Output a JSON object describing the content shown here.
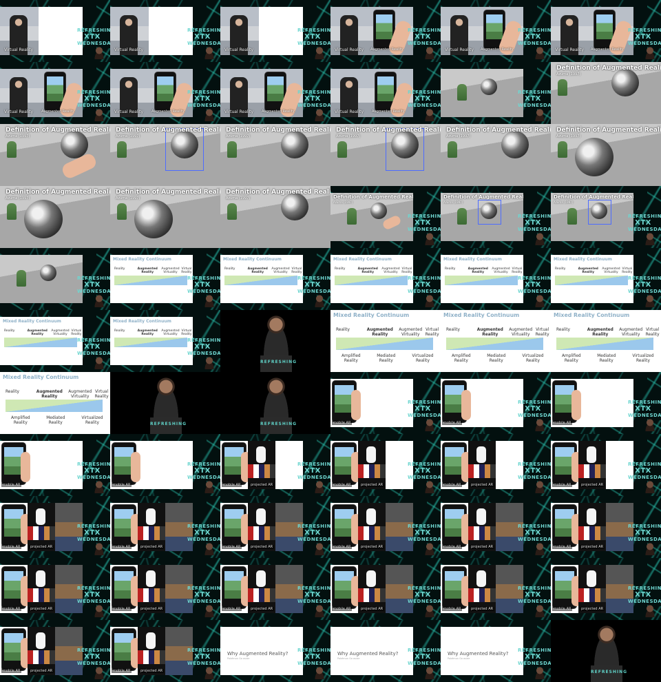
{
  "brand": {
    "line1": "REFRESHING",
    "line2": "XTX",
    "line3": "WEDNESDAY"
  },
  "podium_text": "REFRESHING",
  "captions": {
    "virtual_reality": "Virtual Reality",
    "augmented_reality": "Augmented Reality",
    "mobile_ar": "mobile AR",
    "projection_ar": "projected AR"
  },
  "definition": {
    "title": "Definition of Augmented Reality",
    "subtitle": "Azuma (1997)"
  },
  "mixed_reality": {
    "title": "Mixed Reality Continuum",
    "reality": "Reality",
    "augmented_reality": "Augmented\nReality",
    "augmented_virtuality": "Augmented\nVirtuality",
    "virtual_reality": "Virtual\nReality",
    "amplified_reality": "Amplified\nReality",
    "mediated_reality": "Mediated\nReality",
    "virtualized_reality": "Virtualized\nReality"
  },
  "why": {
    "title": "Why Augmented Reality?",
    "subtitle": "Pokémon Go aside"
  },
  "frames": [
    "vr-white",
    "vr-white",
    "vr-white",
    "ar-phone",
    "ar-phone",
    "ar-phone",
    "ar-split",
    "ar-split",
    "ar-split",
    "ar-split",
    "def-start",
    "def-globe",
    "def-hand",
    "def-box",
    "def-globe",
    "def-box",
    "def-globe",
    "def-big",
    "def-big",
    "def-big",
    "def-globe",
    "def-hand-sm",
    "def-box-sm",
    "def-box-sm",
    "def-brand",
    "mr-small",
    "mr-small",
    "mr-small",
    "mr-small",
    "mr-small",
    "mr-small-b",
    "mr-small-b",
    "speaker",
    "mr-full",
    "mr-full",
    "mr-full",
    "mr-full-lg",
    "speaker-wide",
    "speaker-wide",
    "mobile",
    "mobile",
    "mobile",
    "mobile",
    "mobile",
    "proj",
    "proj",
    "proj",
    "proj",
    "proj-wide",
    "proj-wide",
    "proj-wide",
    "proj-wide",
    "proj-wide",
    "proj-photo",
    "proj-photo",
    "proj-photo",
    "proj-photo",
    "proj-photo",
    "proj-photo",
    "proj-photo",
    "proj-photo",
    "proj-photo",
    "why",
    "why",
    "why",
    "speaker-end"
  ]
}
